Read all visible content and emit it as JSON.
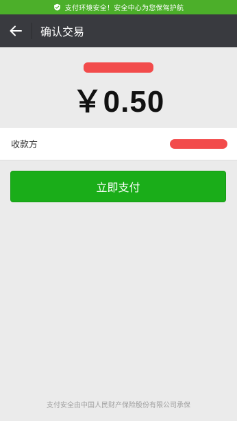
{
  "banner": {
    "text": "支付环境安全！安全中心为您保驾护航",
    "icon": "shield-check-icon"
  },
  "nav": {
    "title": "确认交易",
    "back_icon": "arrow-left-icon"
  },
  "transaction": {
    "amount": "￥0.50",
    "payee_label": "收款方"
  },
  "actions": {
    "pay_label": "立即支付"
  },
  "footer": {
    "text": "支付安全由中国人民财产保险股份有限公司承保"
  },
  "colors": {
    "banner_bg": "#4caf2a",
    "nav_bg": "#393a3f",
    "button_bg": "#1aad19",
    "redaction": "#f24b4b",
    "page_bg": "#ebebeb"
  }
}
